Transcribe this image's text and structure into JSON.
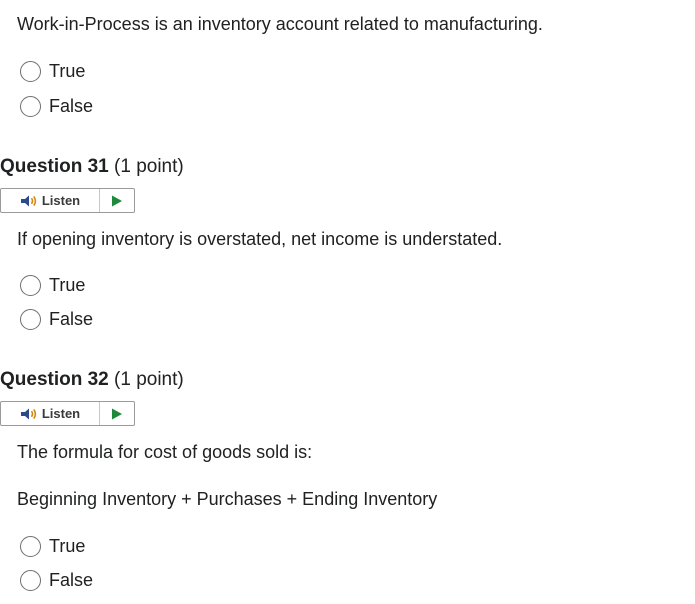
{
  "question_30": {
    "text": "Work-in-Process is an inventory account related to manufacturing.",
    "options": [
      "True",
      "False"
    ]
  },
  "question_31": {
    "title": "Question 31",
    "points": "(1 point)",
    "listen_label": "Listen",
    "text": "If opening inventory is overstated, net income is understated.",
    "options": [
      "True",
      "False"
    ]
  },
  "question_32": {
    "title": "Question 32",
    "points": "(1 point)",
    "listen_label": "Listen",
    "text": "The formula for cost of goods sold is:",
    "text_line2": "Beginning Inventory + Purchases + Ending Inventory",
    "options": [
      "True",
      "False"
    ]
  },
  "icons": {
    "speaker": "speaker-icon",
    "play": "play-icon"
  },
  "colors": {
    "play_green": "#1e8a3c",
    "speaker_blue": "#2b4a8c",
    "speaker_waves": "#d4860b"
  }
}
